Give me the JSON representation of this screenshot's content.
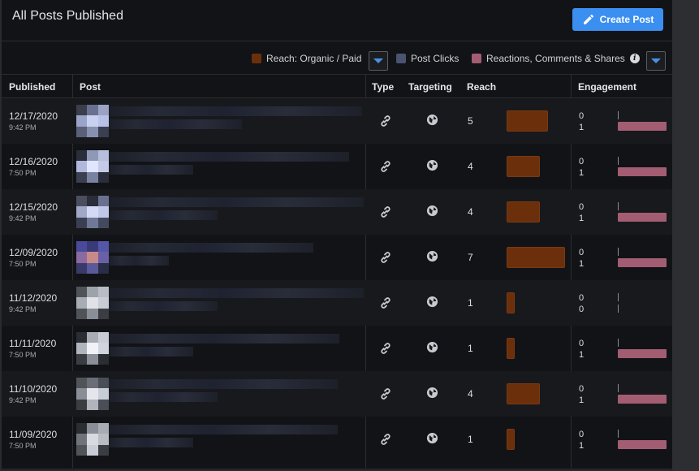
{
  "header": {
    "title": "All Posts Published",
    "create_label": "Create Post"
  },
  "legend": {
    "reach_label": "Reach: Organic / Paid",
    "clicks_label": "Post Clicks",
    "reactions_label": "Reactions, Comments & Shares",
    "colors": {
      "reach": "#6b2f0c",
      "clicks": "#4a5470",
      "reactions": "#a35d72"
    }
  },
  "columns": {
    "published": "Published",
    "post": "Post",
    "type": "Type",
    "targeting": "Targeting",
    "reach": "Reach",
    "engagement": "Engagement"
  },
  "rows": [
    {
      "date": "12/17/2020",
      "time": "9:42 PM",
      "reach": 5,
      "clicks": "0",
      "reactions": "1",
      "type_icon": "link-icon",
      "targeting_icon": "globe-icon"
    },
    {
      "date": "12/16/2020",
      "time": "7:50 PM",
      "reach": 4,
      "clicks": "0",
      "reactions": "1",
      "type_icon": "link-icon",
      "targeting_icon": "globe-icon"
    },
    {
      "date": "12/15/2020",
      "time": "9:42 PM",
      "reach": 4,
      "clicks": "0",
      "reactions": "1",
      "type_icon": "link-icon",
      "targeting_icon": "globe-icon"
    },
    {
      "date": "12/09/2020",
      "time": "7:50 PM",
      "reach": 7,
      "clicks": "0",
      "reactions": "1",
      "type_icon": "link-icon",
      "targeting_icon": "globe-icon"
    },
    {
      "date": "11/12/2020",
      "time": "9:42 PM",
      "reach": 1,
      "clicks": "0",
      "reactions": "0",
      "type_icon": "link-icon",
      "targeting_icon": "globe-icon"
    },
    {
      "date": "11/11/2020",
      "time": "7:50 PM",
      "reach": 1,
      "clicks": "0",
      "reactions": "1",
      "type_icon": "link-icon",
      "targeting_icon": "globe-icon"
    },
    {
      "date": "11/10/2020",
      "time": "9:42 PM",
      "reach": 4,
      "clicks": "0",
      "reactions": "1",
      "type_icon": "link-icon",
      "targeting_icon": "globe-icon"
    },
    {
      "date": "11/09/2020",
      "time": "7:50 PM",
      "reach": 1,
      "clicks": "0",
      "reactions": "1",
      "type_icon": "link-icon",
      "targeting_icon": "globe-icon"
    }
  ]
}
